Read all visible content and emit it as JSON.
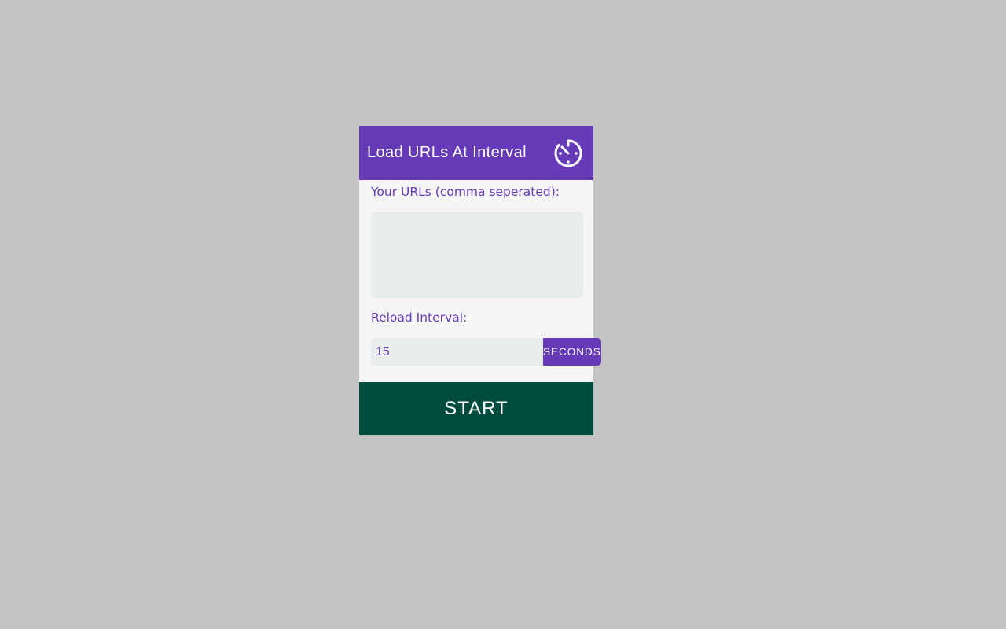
{
  "header": {
    "title": "Load URLs At Interval",
    "icon": "timer-icon"
  },
  "form": {
    "urls_label": "Your URLs (comma seperated):",
    "urls_value": "",
    "interval_label": "Reload Interval:",
    "interval_value": "15",
    "interval_unit": "SECONDS"
  },
  "actions": {
    "start_label": "START"
  },
  "colors": {
    "background": "#c3c3c3",
    "accent": "#673ab7",
    "panel": "#f5f5f6",
    "field": "#e7eced",
    "start": "#004d40"
  }
}
